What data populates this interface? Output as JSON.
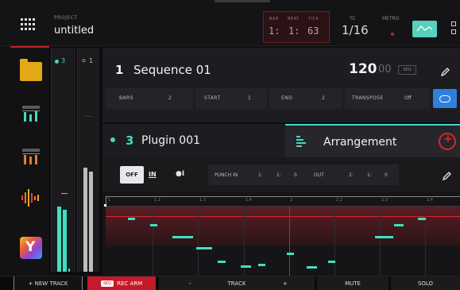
{
  "header": {
    "project_label": "PROJECT",
    "project_name": "untitled",
    "bbt": {
      "bar_label": "BAR",
      "beat_label": "BEAT",
      "tick_label": "TICK",
      "bar": "1:",
      "beat": "1:",
      "tick": "63"
    },
    "tc_label": "TC",
    "tc_value": "1/16",
    "metro_label": "METRO"
  },
  "sequence": {
    "number": "1",
    "name": "Sequence 01",
    "bpm": "120",
    "bpm_fraction": "00",
    "seq_badge": "SEQ",
    "bars_label": "BARS",
    "bars_value": "2",
    "start_label": "START",
    "start_value": "1",
    "end_label": "END",
    "end_value": "2",
    "transpose_label": "TRANSPOSE",
    "transpose_value": "Off"
  },
  "track": {
    "number": "3",
    "name": "Plugin 001",
    "meter_a_num": "3",
    "meter_b_num": "1"
  },
  "arrangement": {
    "label": "Arrangement"
  },
  "automation": {
    "off": "OFF",
    "in": "IN",
    "play": "●I",
    "punch_in_label": "PUNCH IN",
    "punch_in_values": [
      "1:",
      "1:",
      "0"
    ],
    "out_label": "OUT",
    "out_values": [
      "2:",
      "1:",
      "0"
    ]
  },
  "ruler": [
    "1",
    "1.2",
    "1.3",
    "1.4",
    "2",
    "2.2",
    "2.3",
    "2.4"
  ],
  "bottom": {
    "new_track": "+   NEW TRACK",
    "seq_chip": "SEQ",
    "rec_arm": "REC ARM",
    "minus": "-",
    "track": "TRACK",
    "plus": "+",
    "mute": "MUTE",
    "solo": "SOLO"
  },
  "colors": {
    "accent_teal": "#47d8bf",
    "record_red": "#c41a2b",
    "folder_yellow": "#e3a815",
    "loop_blue": "#2f7fdc"
  },
  "icons": [
    "grid-icon",
    "folder-icon",
    "mixer-icon",
    "pad-mixer-icon",
    "eq-icon",
    "app-logo-icon",
    "pencil-icon",
    "loop-icon",
    "arrangement-icon",
    "record-add-icon",
    "waveform-icon"
  ]
}
